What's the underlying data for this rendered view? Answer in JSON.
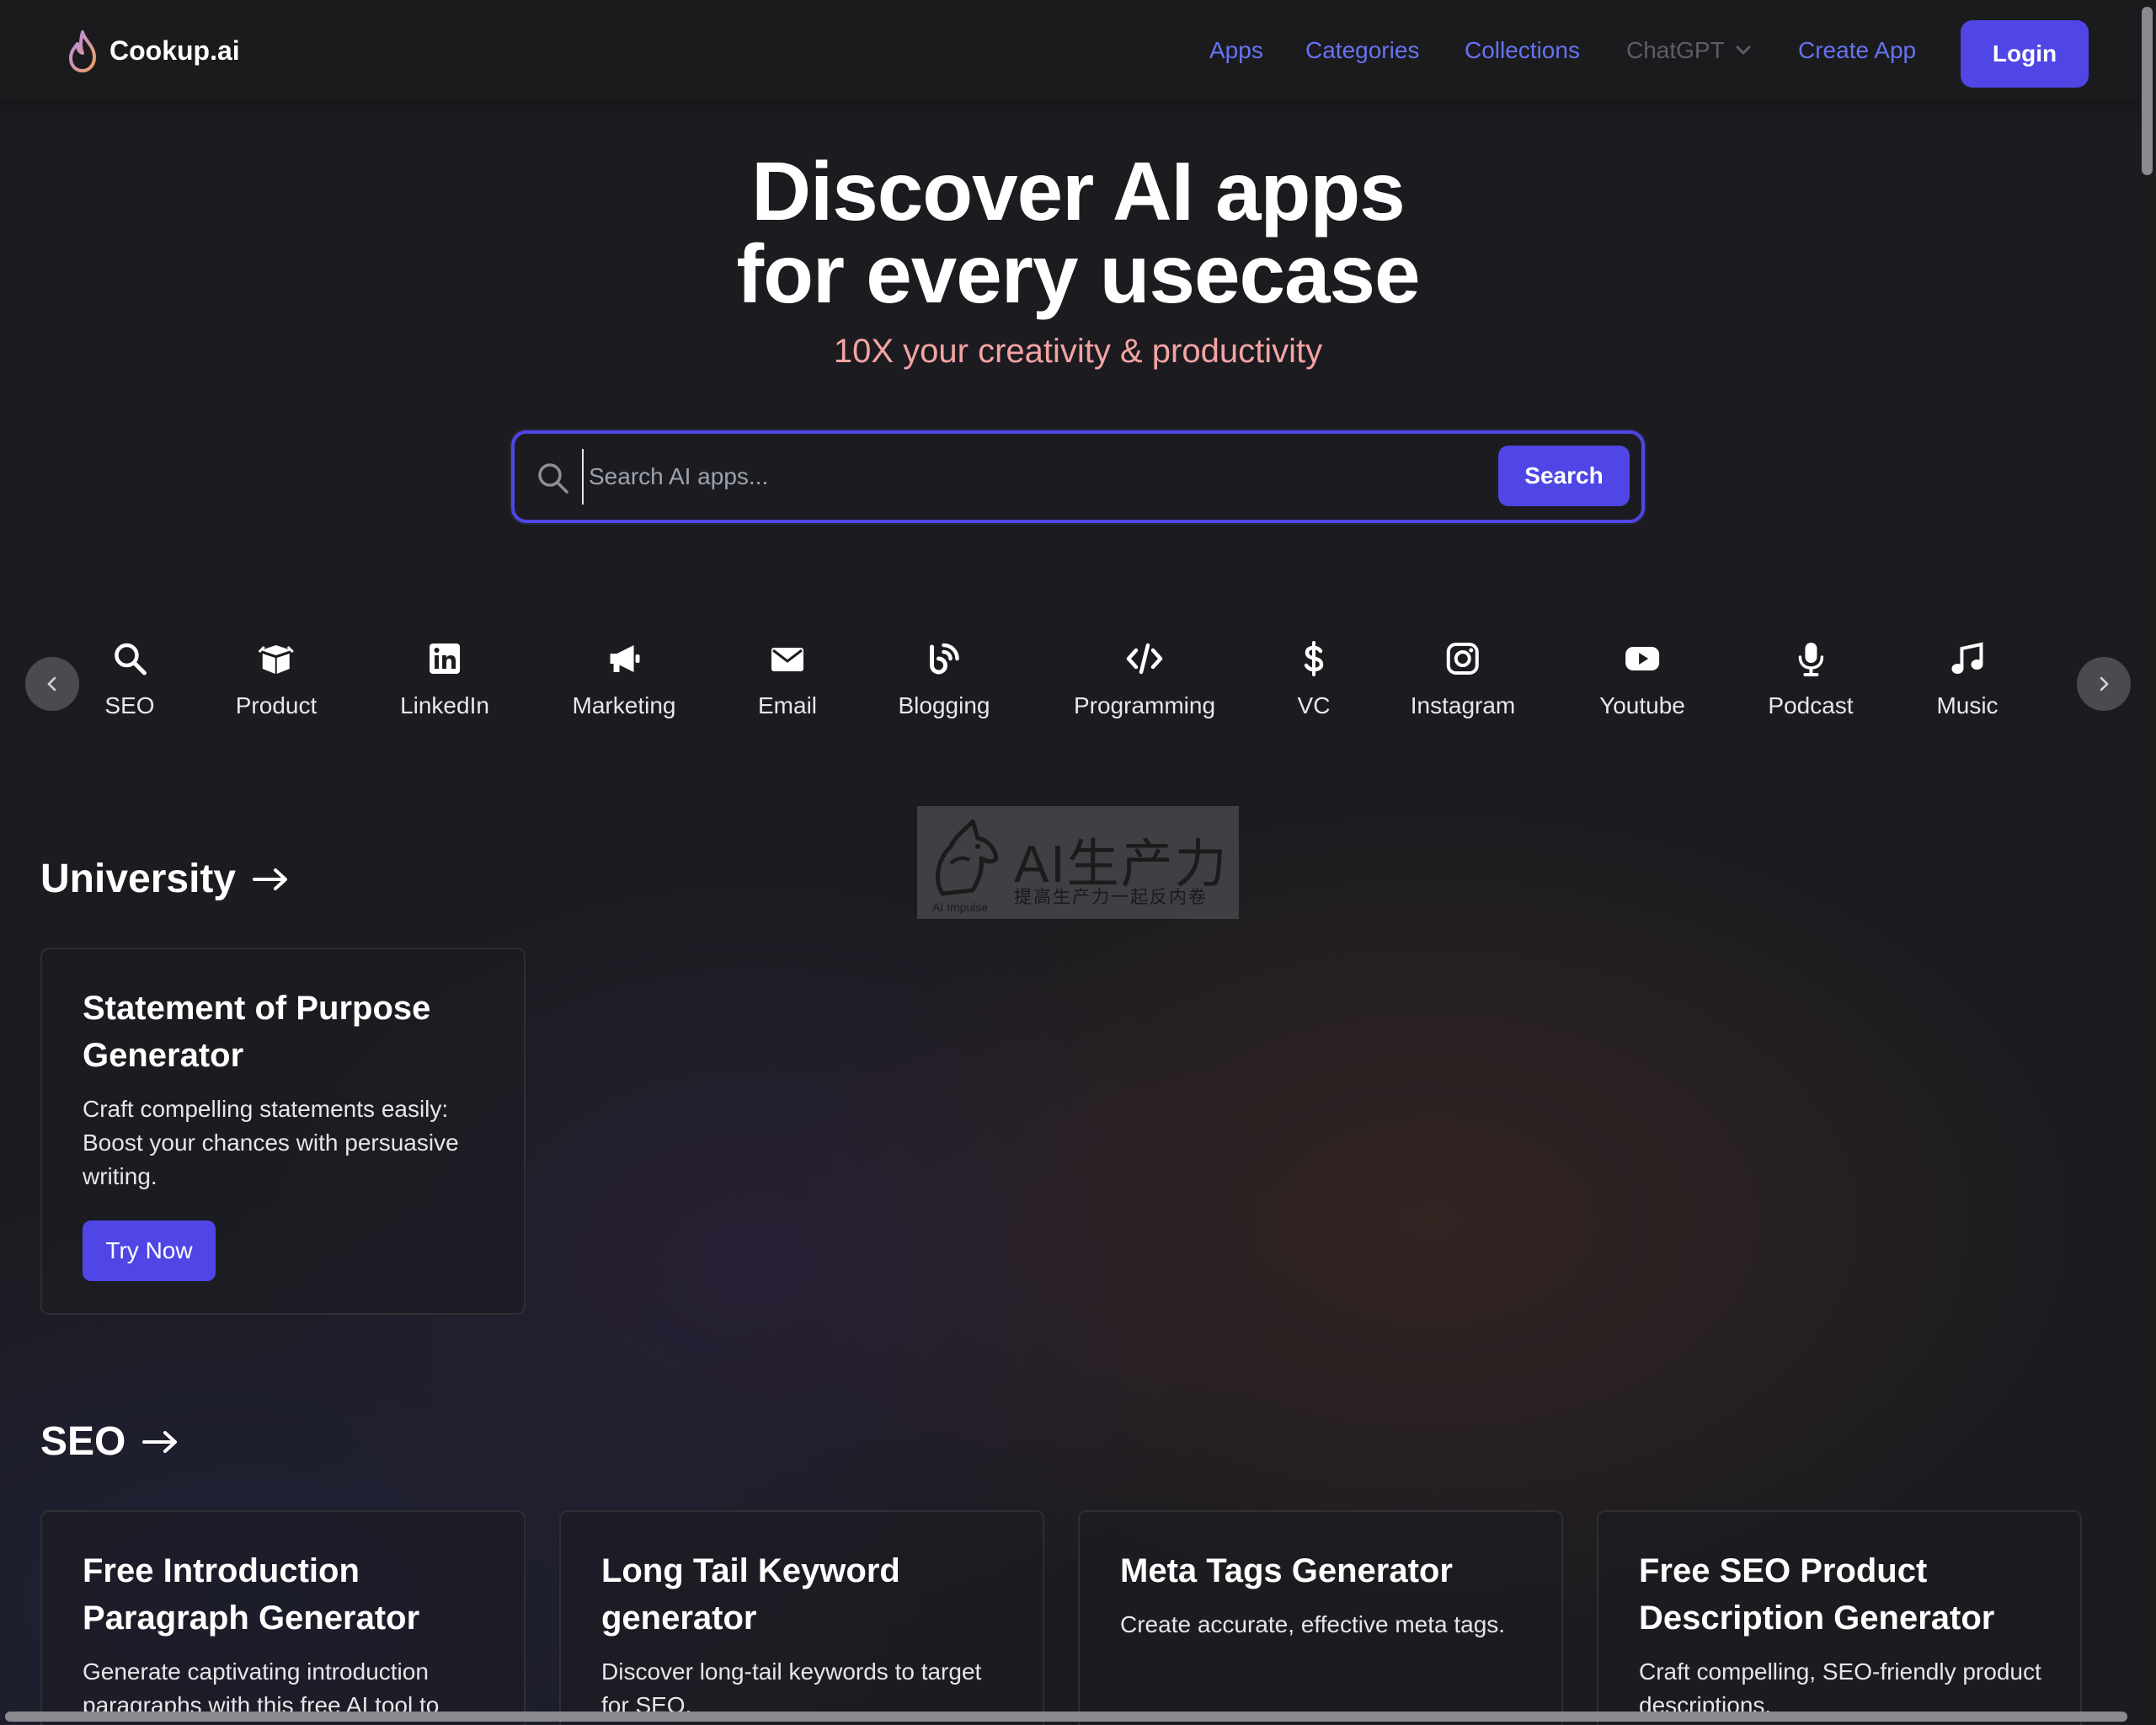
{
  "brand": {
    "name": "Cookup.ai"
  },
  "nav": {
    "apps": "Apps",
    "categories": "Categories",
    "collections": "Collections",
    "chatgpt": "ChatGPT",
    "create_app": "Create App",
    "login": "Login"
  },
  "hero": {
    "title_line1": "Discover AI apps",
    "title_line2": "for every usecase",
    "subtitle": "10X your creativity & productivity"
  },
  "search": {
    "placeholder": "Search AI apps...",
    "value": "",
    "button": "Search"
  },
  "categories": [
    {
      "label": "SEO",
      "icon": "search-icon"
    },
    {
      "label": "Product",
      "icon": "box-icon"
    },
    {
      "label": "LinkedIn",
      "icon": "linkedin-icon"
    },
    {
      "label": "Marketing",
      "icon": "megaphone-icon"
    },
    {
      "label": "Email",
      "icon": "envelope-icon"
    },
    {
      "label": "Blogging",
      "icon": "blog-icon"
    },
    {
      "label": "Programming",
      "icon": "code-icon"
    },
    {
      "label": "VC",
      "icon": "dollar-icon"
    },
    {
      "label": "Instagram",
      "icon": "instagram-icon"
    },
    {
      "label": "Youtube",
      "icon": "youtube-icon"
    },
    {
      "label": "Podcast",
      "icon": "microphone-icon"
    },
    {
      "label": "Music",
      "icon": "music-icon"
    }
  ],
  "watermark": {
    "main": "AI生产力",
    "sub": "提高生产力一起反内卷",
    "small": "AI Impulse"
  },
  "sections": {
    "university": {
      "title": "University",
      "cards": [
        {
          "title": "Statement of Purpose Generator",
          "desc": "Craft compelling statements easily: Boost your chances with persuasive writing.",
          "button": "Try Now"
        }
      ]
    },
    "seo": {
      "title": "SEO",
      "cards": [
        {
          "title": "Free Introduction Paragraph Generator",
          "desc": "Generate captivating introduction paragraphs with this free AI tool to"
        },
        {
          "title": "Long Tail Keyword generator",
          "desc": "Discover long-tail keywords to target for SEO."
        },
        {
          "title": "Meta Tags Generator",
          "desc": "Create accurate, effective meta tags."
        },
        {
          "title": "Free SEO Product Description Generator",
          "desc": "Craft compelling, SEO-friendly product descriptions."
        }
      ]
    }
  },
  "colors": {
    "accent": "#4f46e5",
    "nav_link": "#6673f2",
    "subtitle": "#f4a3a3",
    "background": "#1c1c20"
  }
}
